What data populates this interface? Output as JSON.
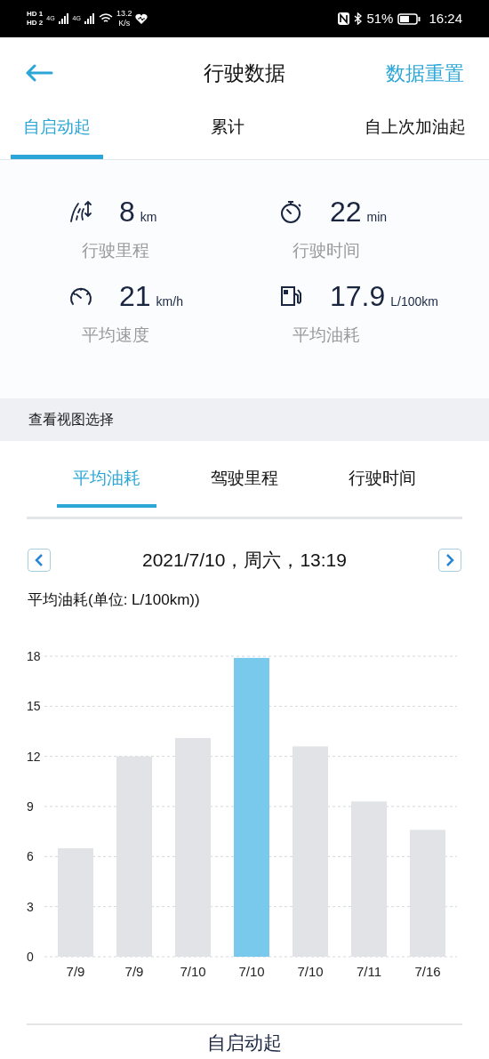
{
  "status_bar": {
    "sim1": "HD 1",
    "sim2": "HD 2",
    "net1": "4G",
    "net2": "4G",
    "speed": "13.2",
    "speed_unit": "K/s",
    "battery": "51%",
    "time": "16:24"
  },
  "header": {
    "title": "行驶数据",
    "action": "数据重置"
  },
  "tabs": [
    {
      "label": "自启动起",
      "selected": true
    },
    {
      "label": "累计",
      "selected": false
    },
    {
      "label": "自上次加油起",
      "selected": false
    }
  ],
  "stats": [
    {
      "kind": "distance",
      "value": "8",
      "unit": "km",
      "label": "行驶里程"
    },
    {
      "kind": "time",
      "value": "22",
      "unit": "min",
      "label": "行驶时间"
    },
    {
      "kind": "speed",
      "value": "21",
      "unit": "km/h",
      "label": "平均速度"
    },
    {
      "kind": "fuel",
      "value": "17.9",
      "unit": "L/100km",
      "label": "平均油耗"
    }
  ],
  "section_title": "查看视图选择",
  "view_tabs": [
    {
      "label": "平均油耗",
      "selected": true
    },
    {
      "label": "驾驶里程",
      "selected": false
    },
    {
      "label": "行驶时间",
      "selected": false
    }
  ],
  "date": "2021/7/10，周六，13:19",
  "chart_label": "平均油耗(单位: L/100km))",
  "chart_data": {
    "type": "bar",
    "categories": [
      "7/9",
      "7/9",
      "7/10",
      "7/10",
      "7/10",
      "7/11",
      "7/16"
    ],
    "ylim": [
      0,
      18
    ],
    "yticks": [
      0,
      3,
      6,
      9,
      12,
      15,
      18
    ],
    "grid": true,
    "values": [
      6.5,
      12,
      13.1,
      17.9,
      12.6,
      9.3,
      7.6
    ],
    "colors": [
      "#e2e3e7",
      "#e2e3e7",
      "#e2e3e7",
      "#78c9eb",
      "#e2e3e7",
      "#e2e3e7",
      "#e2e3e7"
    ]
  },
  "footer_title": "自启动起"
}
